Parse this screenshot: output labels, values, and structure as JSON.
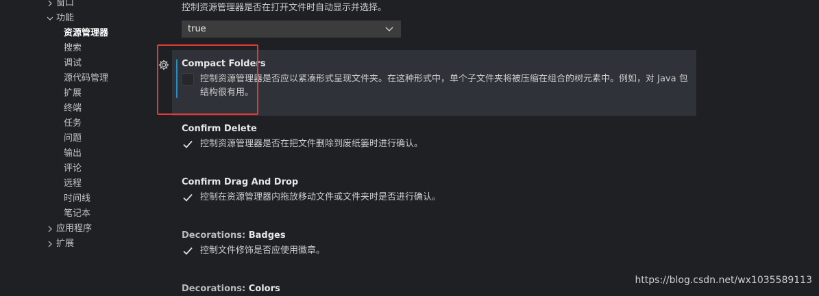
{
  "tree": {
    "window": "窗口",
    "features": "功能",
    "features_items": [
      "资源管理器",
      "搜索",
      "调试",
      "源代码管理",
      "扩展",
      "终端",
      "任务",
      "问题",
      "输出",
      "评论",
      "远程",
      "时间线",
      "笔记本"
    ],
    "application": "应用程序",
    "extensions": "扩展"
  },
  "settings": {
    "open_editors_desc": "控制资源管理器是否在打开文件时自动显示并选择。",
    "auto_reveal_value": "true",
    "compact_folders": {
      "title": "Compact Folders",
      "desc_line1": "控制资源管理器是否应以紧凑形式呈现文件夹。在这种形式中，单个子文件夹将被压缩在组合的树元素中。例如，对 Java 包",
      "desc_line2": "结构很有用。",
      "checked": false
    },
    "confirm_delete": {
      "title": "Confirm Delete",
      "desc": "控制资源管理器是否在把文件删除到废纸篓时进行确认。",
      "checked": true
    },
    "confirm_drag": {
      "title": "Confirm Drag And Drop",
      "desc": "控制在资源管理器内拖放移动文件或文件夹时是否进行确认。",
      "checked": true
    },
    "decorations_badges": {
      "category": "Decorations: ",
      "title": "Badges",
      "desc": "控制文件修饰是否应使用徽章。",
      "checked": true
    },
    "decorations_colors": {
      "category": "Decorations: ",
      "title": "Colors"
    }
  },
  "watermark": "https://blog.csdn.net/wx1035589113",
  "colors": {
    "background": "#1e2024",
    "focus_bar": "#2a8dbb",
    "highlight_box": "#e53935"
  }
}
